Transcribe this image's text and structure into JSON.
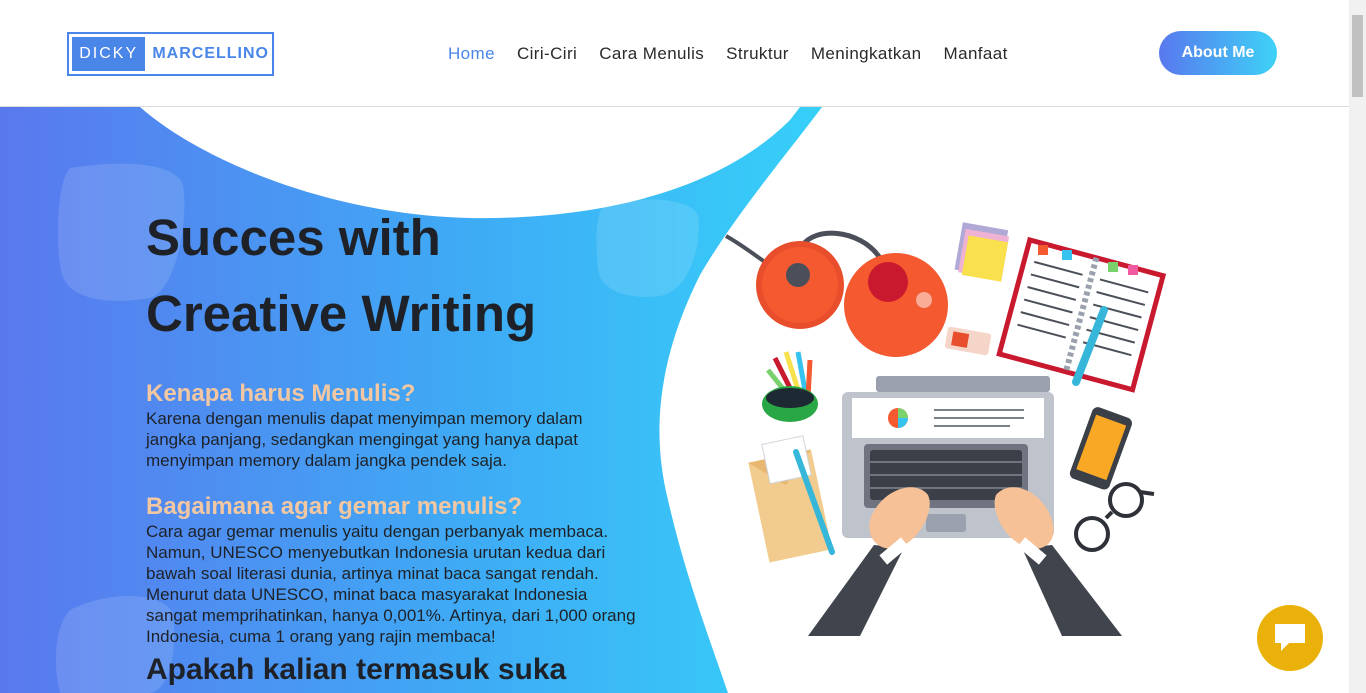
{
  "logo": {
    "part1": "DICKY",
    "part2": "MARCELLINO"
  },
  "nav": [
    {
      "label": "Home"
    },
    {
      "label": "Ciri-Ciri"
    },
    {
      "label": "Cara Menulis"
    },
    {
      "label": "Struktur"
    },
    {
      "label": "Meningkatkan"
    },
    {
      "label": "Manfaat"
    }
  ],
  "about_button": "About Me",
  "hero": {
    "title_line1": "Succes with",
    "title_line2": "Creative Writing",
    "q1": "Kenapa harus Menulis?",
    "p1": "Karena dengan menulis dapat menyimpan memory dalam jangka panjang, sedangkan mengingat yang hanya dapat menyimpan memory dalam jangka pendek saja.",
    "q2": "Bagaimana agar gemar menulis?",
    "p2": "Cara agar gemar menulis yaitu dengan perbanyak membaca. Namun, UNESCO menyebutkan Indonesia urutan kedua dari bawah soal literasi dunia, artinya minat baca sangat rendah. Menurut data UNESCO, minat baca masyarakat Indonesia sangat memprihatinkan, hanya 0,001%. Artinya, dari 1,000 orang Indonesia, cuma 1 orang yang rajin membaca!",
    "subhead": "Apakah kalian termasuk suka"
  },
  "colors": {
    "accent": "#4a86e8",
    "gradient_start": "#5a78ee",
    "gradient_end": "#36d0f8",
    "question": "#f3c7a1",
    "chat": "#e9b109"
  },
  "icons": {
    "chat": "chat-bubble-icon",
    "illustration": "desk-workspace-illustration"
  }
}
